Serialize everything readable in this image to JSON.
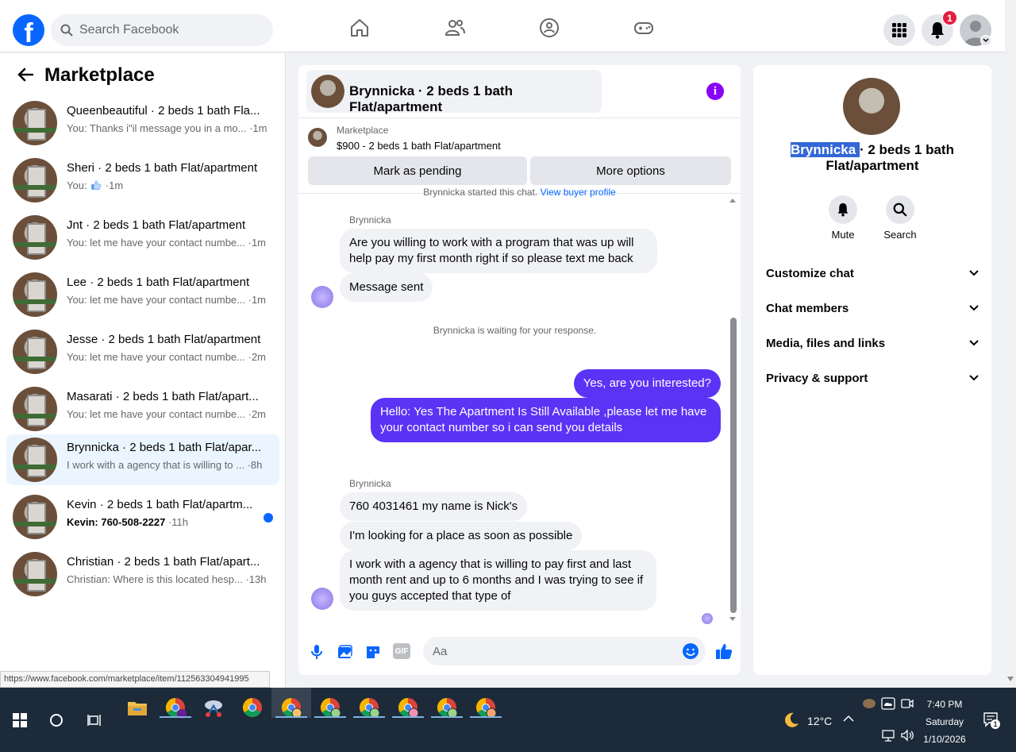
{
  "header": {
    "search_placeholder": "Search Facebook",
    "notification_count": "1",
    "logo_letter": "f"
  },
  "marketplace": {
    "title": "Marketplace",
    "conversations": [
      {
        "title": "Queenbeautiful · 2 beds 1 bath Fla...",
        "preview": "You: Thanks i\"il message you in a mo...",
        "time": " ·1m"
      },
      {
        "title": "Sheri · 2 beds 1 bath Flat/apartment",
        "preview": "You: ",
        "time": " ·1m"
      },
      {
        "title": "Jnt · 2 beds 1 bath Flat/apartment",
        "preview": "You: let me have your contact numbe...",
        "time": " ·1m"
      },
      {
        "title": "Lee · 2 beds 1 bath Flat/apartment",
        "preview": "You: let me have your contact numbe...",
        "time": " ·1m"
      },
      {
        "title": "Jesse · 2 beds 1 bath Flat/apartment",
        "preview": "You: let me have your contact numbe...",
        "time": " ·2m"
      },
      {
        "title": "Masarati · 2 beds 1 bath Flat/apart...",
        "preview": "You: let me have your contact numbe...",
        "time": " ·2m"
      },
      {
        "title": "Brynnicka · 2 beds 1 bath Flat/apar...",
        "preview": "I work with a agency that is willing to ...",
        "time": " ·8h"
      },
      {
        "title": "Kevin · 2 beds 1 bath Flat/apartm...",
        "preview_bold": "Kevin: 760-508-2227",
        "time": " ·11h"
      },
      {
        "title": "Christian · 2 beds 1 bath Flat/apart...",
        "preview": "Christian: Where is this located hesp...",
        "time": " ·13h"
      }
    ],
    "status_url": "https://www.facebook.com/marketplace/item/112563304941995"
  },
  "chat": {
    "title": "Brynnicka · 2 beds 1 bath Flat/apartment",
    "listing_label": "Marketplace",
    "listing_price": "$900 - 2 beds 1 bath Flat/apartment",
    "mark_pending": "Mark as pending",
    "more_options": "More options",
    "started_text": "Brynnicka started this chat.",
    "view_buyer": "View buyer profile",
    "sender_name": "Brynnicka",
    "messages_in_1": [
      "Are you willing to work with a program that was up will help pay my first month right if so please text me back",
      "Message sent"
    ],
    "waiting_notice": "Brynnicka is waiting for your response.",
    "messages_out": [
      "Yes, are you interested?",
      "Hello: Yes The Apartment Is Still Available ,please let me have your contact number so i can send you details"
    ],
    "messages_in_2": [
      "760 4031461 my name is Nick's",
      "I'm looking for a place as soon as possible",
      "I work with a agency that is willing to pay first and last month rent and up to 6 months and I was trying to see if you guys accepted that type of"
    ],
    "composer_placeholder": "Aa",
    "gif_label": "GIF"
  },
  "details": {
    "name_highlight": "Brynnicka ",
    "name_rest": "· 2 beds 1 bath Flat/apartment",
    "mute": "Mute",
    "search": "Search",
    "sections": [
      "Customize chat",
      "Chat members",
      "Media, files and links",
      "Privacy & support"
    ]
  },
  "taskbar": {
    "temperature": "12°C",
    "time": "7:40 PM",
    "day": "Saturday",
    "date": "1/10/2026",
    "action_center_count": "1"
  },
  "colors": {
    "brand": "#0866ff",
    "outgoing_bubble": "#5a33f5",
    "info": "#8a05f5"
  }
}
